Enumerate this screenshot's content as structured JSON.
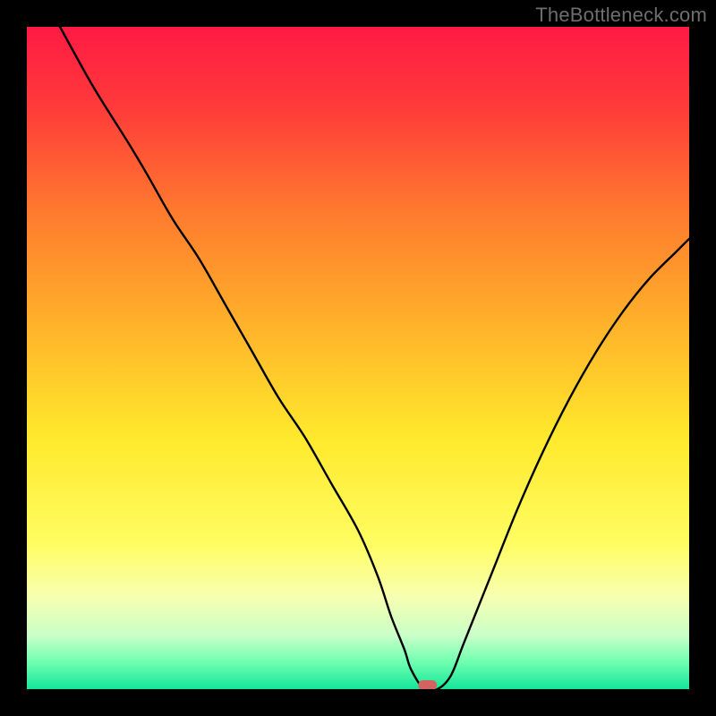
{
  "attribution": "TheBottleneck.com",
  "chart_data": {
    "type": "line",
    "title": "",
    "xlabel": "",
    "ylabel": "",
    "xlim": [
      0,
      100
    ],
    "ylim": [
      0,
      100
    ],
    "grid": false,
    "legend": false,
    "gradient_stops": [
      {
        "offset": 0.0,
        "color": "#ff1a44"
      },
      {
        "offset": 0.12,
        "color": "#ff3a3a"
      },
      {
        "offset": 0.28,
        "color": "#ff7a2e"
      },
      {
        "offset": 0.45,
        "color": "#ffb22a"
      },
      {
        "offset": 0.62,
        "color": "#ffe92c"
      },
      {
        "offset": 0.78,
        "color": "#fffd62"
      },
      {
        "offset": 0.86,
        "color": "#f8ffb0"
      },
      {
        "offset": 0.92,
        "color": "#c8ffc8"
      },
      {
        "offset": 0.96,
        "color": "#6dffb0"
      },
      {
        "offset": 1.0,
        "color": "#14e59a"
      }
    ],
    "series": [
      {
        "name": "bottleneck-curve",
        "x": [
          5,
          10,
          15,
          18,
          22,
          26,
          30,
          34,
          38,
          42,
          46,
          50,
          53,
          55,
          57,
          58,
          60,
          62,
          64,
          66,
          70,
          74,
          78,
          82,
          86,
          90,
          94,
          98,
          100
        ],
        "y": [
          100,
          91,
          83,
          78,
          71,
          65,
          58,
          51,
          44,
          38,
          31,
          24,
          17,
          11,
          6,
          3,
          0,
          0,
          2,
          7,
          17,
          27,
          36,
          44,
          51,
          57,
          62,
          66,
          68
        ]
      }
    ],
    "marker": {
      "x": 60.5,
      "y": 0.6,
      "color": "#d2635e"
    }
  }
}
